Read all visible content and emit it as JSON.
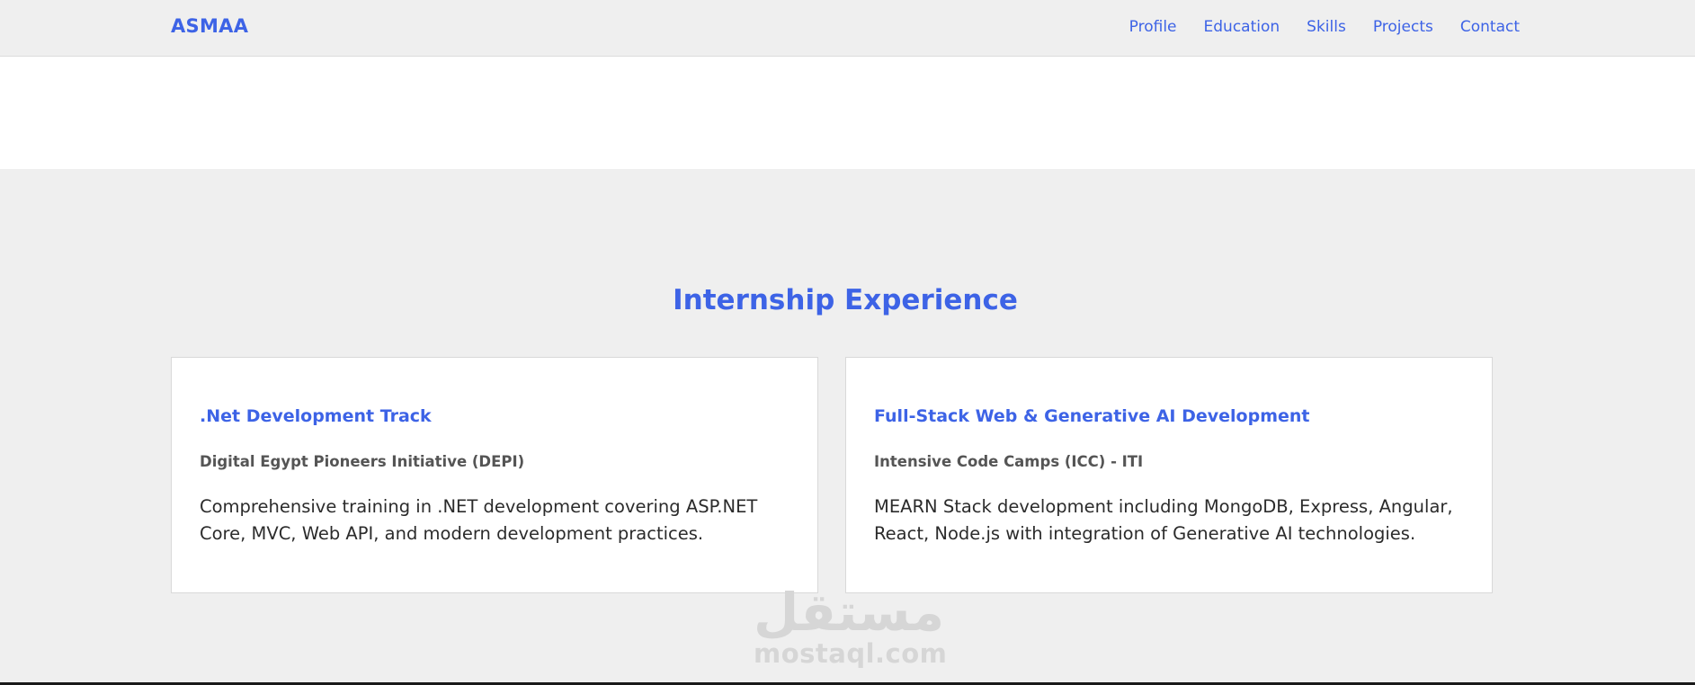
{
  "navbar": {
    "brand": "ASMAA",
    "links": [
      "Profile",
      "Education",
      "Skills",
      "Projects",
      "Contact"
    ]
  },
  "section": {
    "title": "Internship Experience",
    "cards": [
      {
        "title": ".Net Development Track",
        "organization": "Digital Egypt Pioneers Initiative (DEPI)",
        "description": "Comprehensive training in .NET development covering ASP.NET Core, MVC, Web API, and modern development practices."
      },
      {
        "title": "Full-Stack Web & Generative AI Development",
        "organization": "Intensive Code Camps (ICC) - ITI",
        "description": "MEARN Stack development including MongoDB, Express, Angular, React, Node.js with integration of Generative AI technologies."
      }
    ]
  },
  "watermark": {
    "arabic": "مستقل",
    "latin": "mostaql.com"
  },
  "colors": {
    "accent": "#3d63e6",
    "background": "#efefef",
    "card": "#ffffff",
    "text": "#2b2b2b",
    "muted": "#555555"
  }
}
